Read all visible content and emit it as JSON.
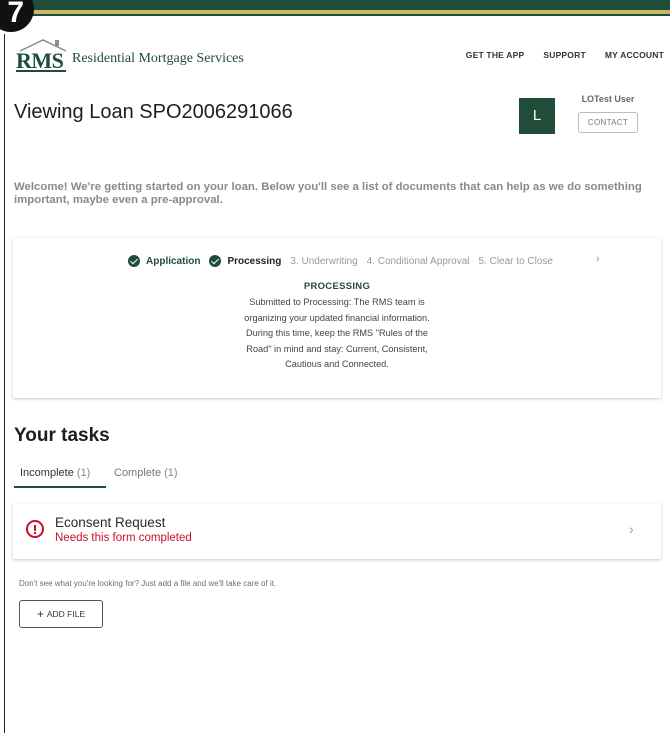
{
  "step_badge": "7",
  "brand": {
    "logo_text": "RMS",
    "company": "Residential Mortgage Services",
    "colors": {
      "primary": "#1f4d3a",
      "accent": "#c9b86a",
      "alert": "#c8102e"
    }
  },
  "nav": {
    "get_app": "GET THE APP",
    "support": "SUPPORT",
    "my_account": "MY ACCOUNT"
  },
  "page": {
    "title": "Viewing Loan SPO2006291066"
  },
  "user": {
    "initial": "L",
    "name": "LOTest User",
    "contact_label": "CONTACT"
  },
  "welcome": "Welcome! We're getting started on your loan. Below you'll see a list of documents that can help as we do something important, maybe even a pre-approval.",
  "progress": {
    "steps": [
      {
        "label": "Application",
        "state": "done"
      },
      {
        "label": "Processing",
        "state": "current"
      },
      {
        "label": "3. Underwriting",
        "state": "future"
      },
      {
        "label": "4. Conditional Approval",
        "state": "future"
      },
      {
        "label": "5. Clear to Close",
        "state": "future"
      }
    ],
    "next_icon": "chevron-right-icon",
    "stage_title": "PROCESSING",
    "stage_desc": "Submitted to Processing: The RMS team is organizing your updated financial information. During this time, keep the RMS \"Rules of the Road\" in mind and stay: Current, Consistent, Cautious and Connected."
  },
  "tasks": {
    "title": "Your tasks",
    "tabs": [
      {
        "label": "Incomplete",
        "count": "(1)"
      },
      {
        "label": "Complete",
        "count": "(1)"
      }
    ],
    "items": [
      {
        "name": "Econsent Request",
        "status": "Needs this form completed",
        "icon": "alert-circle-icon"
      }
    ]
  },
  "hint": "Don't see what you're looking for? Just add a file and we'll take care of it.",
  "add_file_label": "ADD FILE"
}
